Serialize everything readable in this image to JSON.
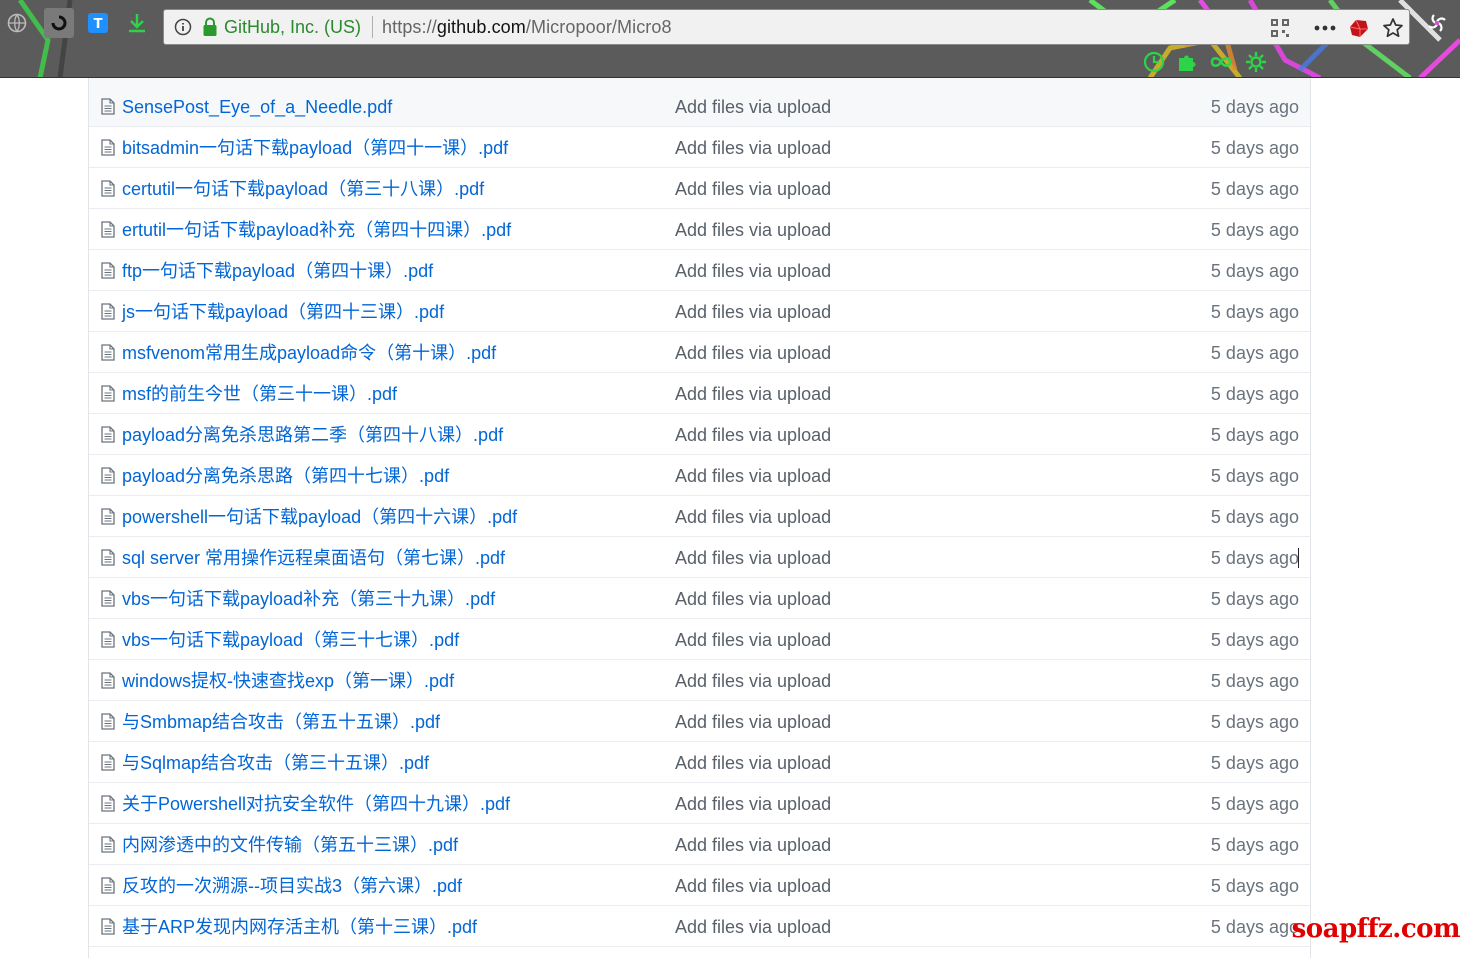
{
  "browser": {
    "org_label": "GitHub, Inc. (US)",
    "url_scheme": "https://",
    "url_host": "github.com",
    "url_path": "/Micropoor/Micro8",
    "toolbar_icons": [
      "globe-icon",
      "circle-app-icon",
      "translate-icon",
      "download-icon"
    ],
    "right_icons": [
      "qr-code-icon",
      "more-icon",
      "ruby-icon",
      "bookmark-star-icon",
      "extension-spiral-icon"
    ],
    "extension_icons": [
      "clock-icon",
      "puzzle-icon",
      "infinity-icon",
      "settings-gear-icon"
    ],
    "accent_green": "#2dd44a",
    "translate_blue": "#1e90ff"
  },
  "files": [
    {
      "name": "SensePost_Eye_of_a_Needle.pdf",
      "message": "Add files via upload",
      "age": "5 days ago"
    },
    {
      "name": "bitsadmin一句话下载payload（第四十一课）.pdf",
      "message": "Add files via upload",
      "age": "5 days ago"
    },
    {
      "name": "certutil一句话下载payload（第三十八课）.pdf",
      "message": "Add files via upload",
      "age": "5 days ago"
    },
    {
      "name": "ertutil一句话下载payload补充（第四十四课）.pdf",
      "message": "Add files via upload",
      "age": "5 days ago"
    },
    {
      "name": "ftp一句话下载payload（第四十课）.pdf",
      "message": "Add files via upload",
      "age": "5 days ago"
    },
    {
      "name": "js一句话下载payload（第四十三课）.pdf",
      "message": "Add files via upload",
      "age": "5 days ago"
    },
    {
      "name": "msfvenom常用生成payload命令（第十课）.pdf",
      "message": "Add files via upload",
      "age": "5 days ago"
    },
    {
      "name": "msf的前生今世（第三十一课）.pdf",
      "message": "Add files via upload",
      "age": "5 days ago"
    },
    {
      "name": "payload分离免杀思路第二季（第四十八课）.pdf",
      "message": "Add files via upload",
      "age": "5 days ago"
    },
    {
      "name": "payload分离免杀思路（第四十七课）.pdf",
      "message": "Add files via upload",
      "age": "5 days ago"
    },
    {
      "name": "powershell一句话下载payload（第四十六课）.pdf",
      "message": "Add files via upload",
      "age": "5 days ago"
    },
    {
      "name": "sql server 常用操作远程桌面语句（第七课）.pdf",
      "message": "Add files via upload",
      "age": "5 days ago"
    },
    {
      "name": "vbs一句话下载payload补充（第三十九课）.pdf",
      "message": "Add files via upload",
      "age": "5 days ago"
    },
    {
      "name": "vbs一句话下载payload（第三十七课）.pdf",
      "message": "Add files via upload",
      "age": "5 days ago"
    },
    {
      "name": "windows提权-快速查找exp（第一课）.pdf",
      "message": "Add files via upload",
      "age": "5 days ago"
    },
    {
      "name": "与Smbmap结合攻击（第五十五课）.pdf",
      "message": "Add files via upload",
      "age": "5 days ago"
    },
    {
      "name": "与Sqlmap结合攻击（第三十五课）.pdf",
      "message": "Add files via upload",
      "age": "5 days ago"
    },
    {
      "name": "关于Powershell对抗安全软件（第四十九课）.pdf",
      "message": "Add files via upload",
      "age": "5 days ago"
    },
    {
      "name": "内网渗透中的文件传输（第五十三课）.pdf",
      "message": "Add files via upload",
      "age": "5 days ago"
    },
    {
      "name": "反攻的一次溯源--项目实战3（第六课）.pdf",
      "message": "Add files via upload",
      "age": "5 days ago"
    },
    {
      "name": "基于ARP发现内网存活主机（第十三课）.pdf",
      "message": "Add files via upload",
      "age": "5 days ago"
    }
  ],
  "watermark": "soapffz.com"
}
